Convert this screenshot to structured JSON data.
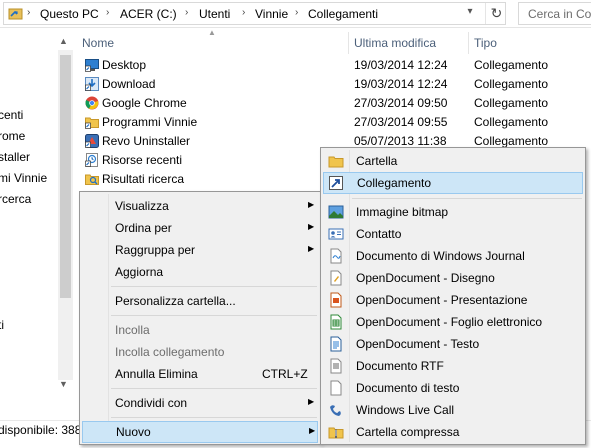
{
  "address": {
    "segments": [
      "Questo PC",
      "ACER (C:)",
      "Utenti",
      "Vinnie",
      "Collegamenti"
    ],
    "search_placeholder": "Cerca in Col"
  },
  "nav": {
    "items": [
      "centi",
      "rome",
      "staller",
      "mi Vinnie",
      "rcerca",
      "ti"
    ]
  },
  "columns": {
    "name": "Nome",
    "modified": "Ultima modifica",
    "type": "Tipo"
  },
  "files": [
    {
      "name": "Desktop",
      "date": "19/03/2014 12:24",
      "type": "Collegamento",
      "icon": "desktop-shortcut-icon"
    },
    {
      "name": "Download",
      "date": "19/03/2014 12:24",
      "type": "Collegamento",
      "icon": "download-shortcut-icon"
    },
    {
      "name": "Google Chrome",
      "date": "27/03/2014 09:50",
      "type": "Collegamento",
      "icon": "chrome-shortcut-icon"
    },
    {
      "name": "Programmi Vinnie",
      "date": "27/03/2014 09:55",
      "type": "Collegamento",
      "icon": "folder-shortcut-icon"
    },
    {
      "name": "Revo Uninstaller",
      "date": "05/07/2013 11:38",
      "type": "Collegamento",
      "icon": "revo-shortcut-icon"
    },
    {
      "name": "Risorse recenti",
      "date": "",
      "type": "",
      "icon": "recent-shortcut-icon"
    },
    {
      "name": "Risultati ricerca",
      "date": "",
      "type": "",
      "icon": "search-results-shortcut-icon"
    }
  ],
  "status": {
    "text": "disponibile: 388"
  },
  "context_menu": {
    "visualizza": "Visualizza",
    "ordina": "Ordina per",
    "raggruppa": "Raggruppa per",
    "aggiorna": "Aggiorna",
    "personalizza": "Personalizza cartella...",
    "incolla": "Incolla",
    "incolla_collegamento": "Incolla collegamento",
    "annulla": "Annulla Elimina",
    "annulla_shortcut": "CTRL+Z",
    "condividi": "Condividi con",
    "nuovo": "Nuovo"
  },
  "submenu": {
    "items": [
      "Cartella",
      "Collegamento",
      "Immagine bitmap",
      "Contatto",
      "Documento di Windows Journal",
      "OpenDocument - Disegno",
      "OpenDocument - Presentazione",
      "OpenDocument - Foglio elettronico",
      "OpenDocument - Testo",
      "Documento RTF",
      "Documento di testo",
      "Windows Live Call",
      "Cartella compressa"
    ]
  },
  "colors": {
    "highlight": "#cde6f7",
    "highlight_border": "#99c9ef",
    "menu_bg": "#f0f0f0",
    "column_header": "#4c607a"
  }
}
